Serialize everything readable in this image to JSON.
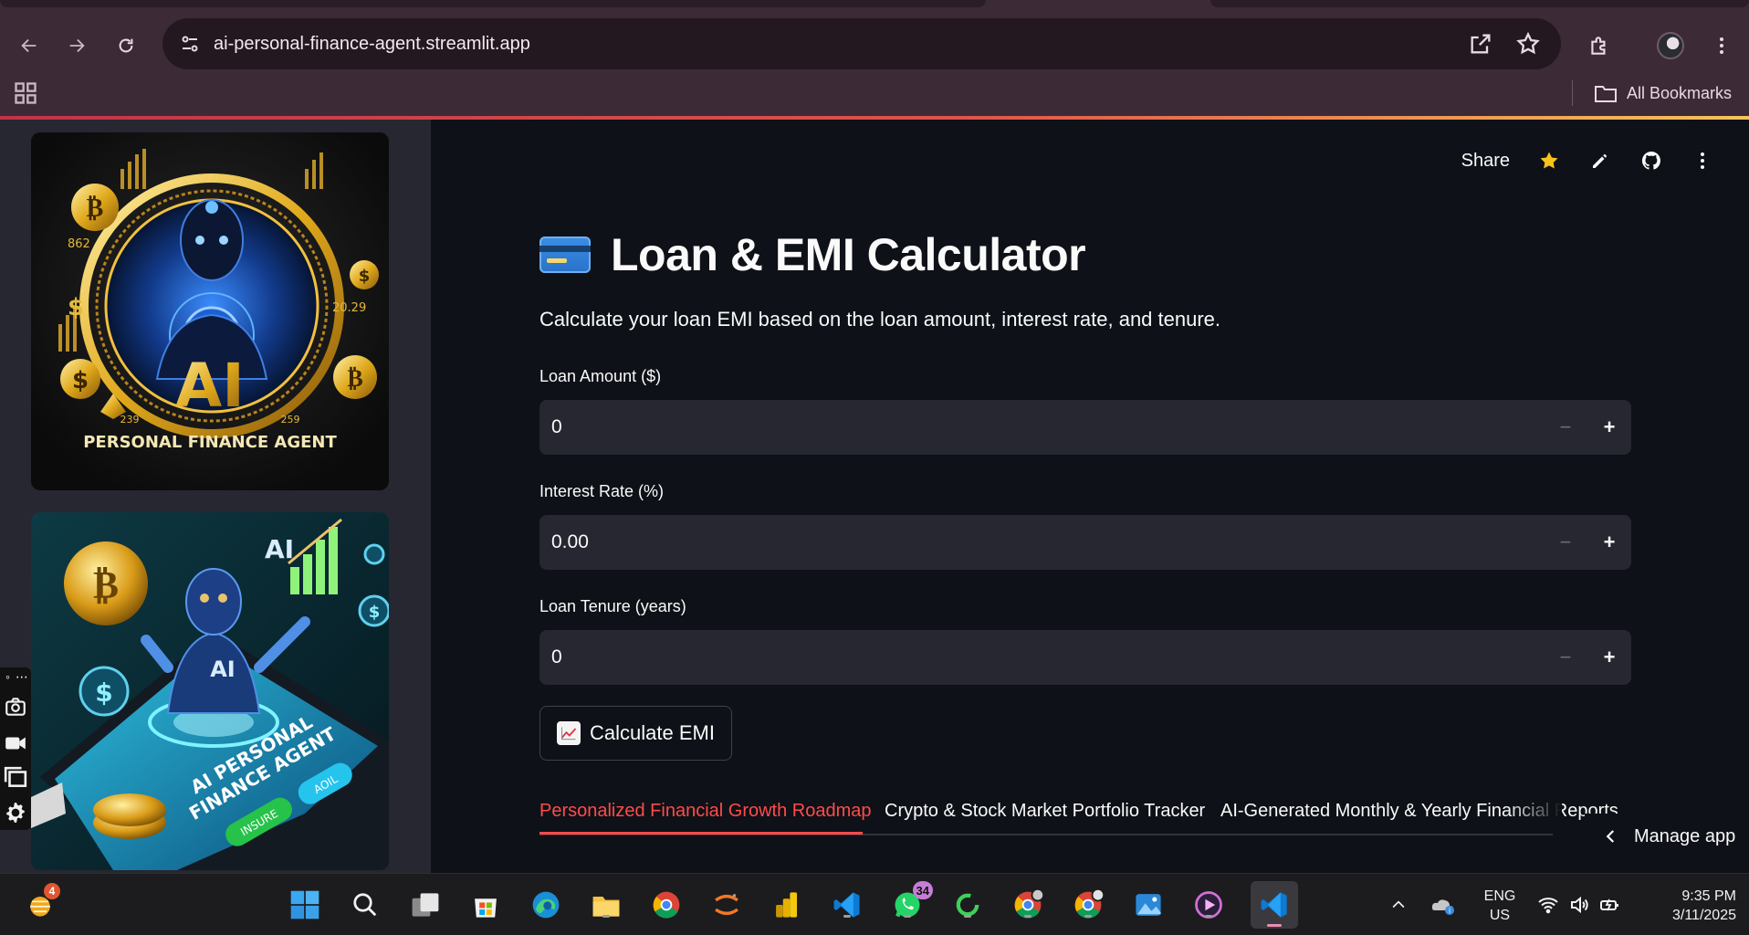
{
  "browser": {
    "url": "ai-personal-finance-agent.streamlit.app",
    "bookmarks_label": "All Bookmarks"
  },
  "header": {
    "share_label": "Share"
  },
  "main": {
    "title": "Loan & EMI Calculator",
    "subtitle": "Calculate your loan EMI based on the loan amount, interest rate, and tenure.",
    "fields": [
      {
        "label": "Loan Amount ($)",
        "value": "0"
      },
      {
        "label": "Interest Rate (%)",
        "value": "0.00"
      },
      {
        "label": "Loan Tenure (years)",
        "value": "0"
      }
    ],
    "calculate_label": "Calculate EMI",
    "tabs": [
      {
        "label": "Personalized Financial Growth Roadmap",
        "active": true
      },
      {
        "label": "Crypto & Stock Market Portfolio Tracker",
        "active": false
      },
      {
        "label": "AI-Generated Monthly & Yearly Financial Reports",
        "active": false
      }
    ],
    "manage_app_label": "Manage app"
  },
  "sidebar": {
    "image1": {
      "line1": "AI",
      "line2": "PERSONAL FINANCE AGENT",
      "left_number": "239",
      "right_number": "259",
      "year": "20.29",
      "small_number": "862"
    },
    "image2": {
      "ai": "AI",
      "robot_label": "AI",
      "screen_line1": "AI PERSONAL",
      "screen_line2": "FINANCE AGENT",
      "btn1": "INSURE",
      "btn2": "AOIL"
    }
  },
  "taskbar": {
    "widget_badge": "4",
    "whatsapp_badge": "34",
    "lang_line1": "ENG",
    "lang_line2": "US",
    "time": "9:35 PM",
    "date": "3/11/2025"
  },
  "colors": {
    "accent": "#ff4b4b",
    "sidebar_bg": "#262730",
    "main_bg": "#0e1117",
    "chrome_bg": "#3c2a36",
    "taskbar_bg": "#1c1c1e"
  }
}
